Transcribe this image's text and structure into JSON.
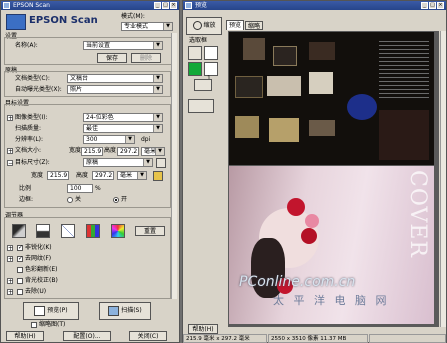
{
  "left_window": {
    "title": "EPSON Scan",
    "brand": "EPSON Scan",
    "mode_label": "模式(M):",
    "mode_value": "专业模式",
    "settings_section": "设置",
    "name_label": "名称(A):",
    "name_value": "当前设置",
    "save_button": "保存",
    "delete_button": "删除",
    "original_section": "原稿",
    "doc_type_label": "文档类型(C):",
    "doc_type_value": "文稿台",
    "auto_exposure_label": "自动曝光类型(X):",
    "auto_exposure_value": "照片",
    "target_section": "目标设置",
    "image_type_label": "图像类型(I):",
    "image_type_value": "24-位彩色",
    "scan_quality_label": "扫描质量:",
    "scan_quality_value": "最佳",
    "resolution_label": "分辨率(L):",
    "resolution_value": "300",
    "resolution_unit": "dpi",
    "doc_size_label": "文档大小:",
    "width_label": "宽度",
    "doc_width": "215.9",
    "height_label": "高度",
    "doc_height": "297.2",
    "doc_unit": "毫米",
    "target_size_label": "目标尺寸(Z):",
    "target_size_value": "原稿",
    "width2_label": "宽度",
    "target_width": "215.9",
    "height2_label": "高度",
    "target_height": "297.2",
    "target_unit": "毫米",
    "scale_label": "比例",
    "scale_value": "100",
    "scale_unit": "%",
    "trim_label": "边框:",
    "trim_on": "关",
    "trim_off": "开",
    "adjust_section": "调节器",
    "reset_button": "重置",
    "option_unsharp": "非锐化(K)",
    "option_descreen": "去网纹(F)",
    "option_color_restore": "色彩翻新(E)",
    "option_backlight": "背光校正(B)",
    "option_dust": "去除(U)",
    "preview_button": "预览(P)",
    "thumbnail_label": "缩略图(T)",
    "scan_button": "扫描(S)",
    "help_button": "帮助(H)",
    "config_button": "配置(O)...",
    "close_button": "关闭(C)"
  },
  "right_window": {
    "title": "预览",
    "zoom_button": "缩放",
    "tab_preview": "预览",
    "tab_thumbnail": "缩略",
    "marquee_label": "选取框",
    "help_button": "帮助(H)",
    "status_size": "215.9 毫米 x 297.2 毫米",
    "status_pixels": "2550 x 3510 像素 11.37 MB",
    "watermark_main": "PConline.com.cn",
    "watermark_sub": "太 平 洋 电 脑 网",
    "magazine_text": "COVER"
  }
}
